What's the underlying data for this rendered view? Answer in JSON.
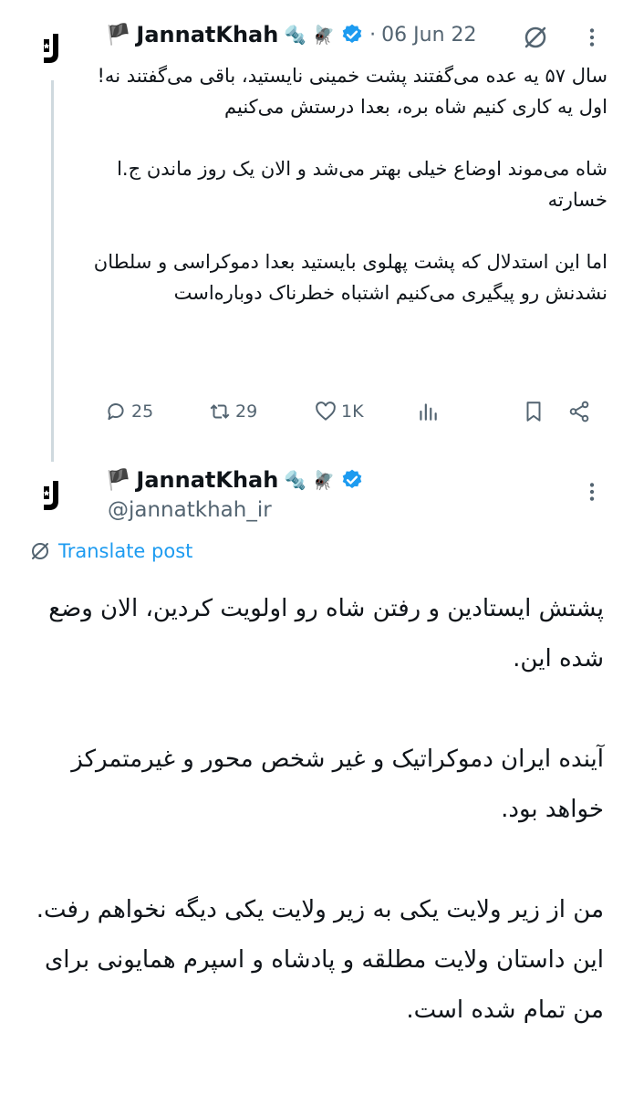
{
  "tweet1": {
    "display_name": "JannatKhah",
    "flag": "🏴",
    "emojis": [
      "🔩",
      "🪰"
    ],
    "date_separator": "·",
    "date": "06 Jun 22",
    "text": "سال ۵۷ یه عده می‌گفتند پشت خمینی نایستید، باقی می‌گفتند نه! اول یه کاری کنیم شاه بره، بعدا درستش می‌کنیم\n\nشاه می‌موند اوضاع خیلی بهتر می‌شد و الان یک روز ماندن ج.ا خسارته\n\nاما این استدلال که پشت پهلوی بایستید بعدا دموکراسی و سلطان نشدنش رو پیگیری می‌کنیم اشتباه خطرناک دوباره‌است",
    "stats": {
      "replies": "25",
      "reposts": "29",
      "likes": "1K"
    }
  },
  "tweet2": {
    "display_name": "JannatKhah",
    "flag": "🏴",
    "emojis": [
      "🔩",
      "🪰"
    ],
    "handle": "@jannatkhah_ir",
    "translate_label": "Translate post",
    "text": "پشتش ایستادین و رفتن شاه رو اولویت کردین، الان وضع شده این.\n\nآینده ایران دموکراتیک و غیر شخص محور و غیرمتمرکز خواهد بود.\n\nمن از زیر ولایت یکی به زیر ولایت یکی دیگه نخواهم رفت.\nاین داستان ولایت مطلقه و پادشاه و اسپرم همایونی برای من تمام شده است."
  },
  "colors": {
    "accent": "#1d9bf0",
    "secondary_text": "#536471",
    "thread_line": "#cfd9de"
  }
}
